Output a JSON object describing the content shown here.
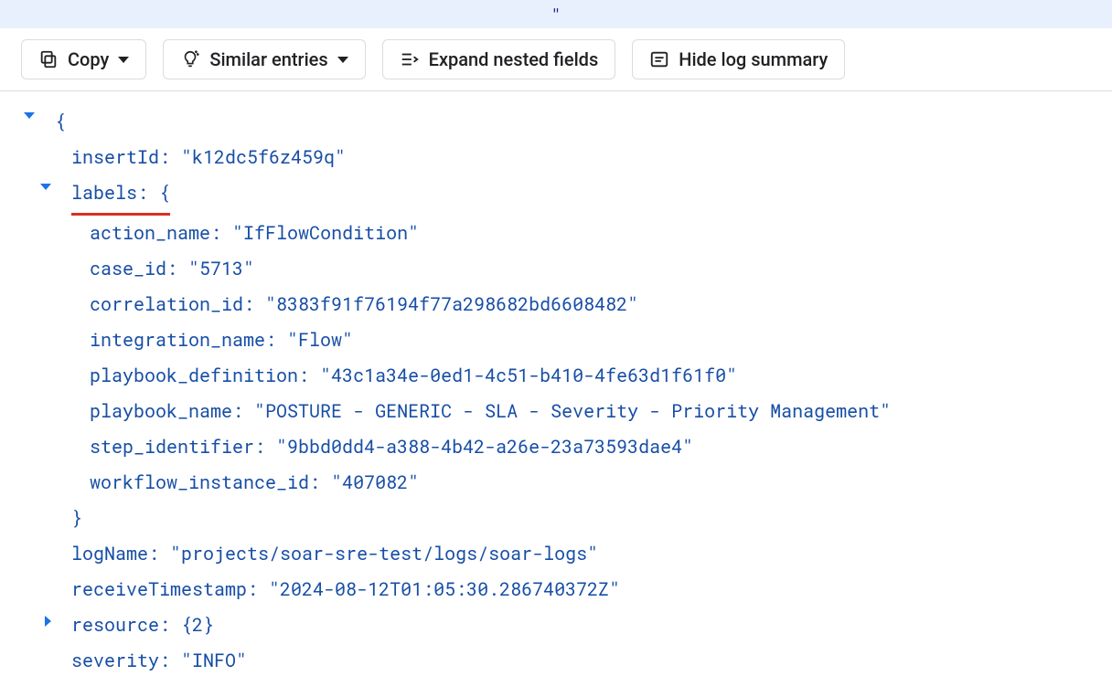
{
  "topstrip": {
    "char": "\""
  },
  "toolbar": {
    "copy": "Copy",
    "similar": "Similar entries",
    "expand": "Expand nested fields",
    "hide": "Hide log summary"
  },
  "log": {
    "open_brace": "{",
    "insertId": {
      "key": "insertId",
      "value": "\"k12dc5f6z459q\""
    },
    "labels_key": "labels",
    "labels_open": "{",
    "labels": {
      "action_name": {
        "key": "action_name",
        "value": "\"IfFlowCondition\""
      },
      "case_id": {
        "key": "case_id",
        "value": "\"5713\""
      },
      "correlation_id": {
        "key": "correlation_id",
        "value": "\"8383f91f76194f77a298682bd6608482\""
      },
      "integration_name": {
        "key": "integration_name",
        "value": "\"Flow\""
      },
      "playbook_definition": {
        "key": "playbook_definition",
        "value": "\"43c1a34e-0ed1-4c51-b410-4fe63d1f61f0\""
      },
      "playbook_name": {
        "key": "playbook_name",
        "value": "\"POSTURE - GENERIC - SLA - Severity - Priority Management\""
      },
      "step_identifier": {
        "key": "step_identifier",
        "value": "\"9bbd0dd4-a388-4b42-a26e-23a73593dae4\""
      },
      "workflow_instance_id": {
        "key": "workflow_instance_id",
        "value": "\"407082\""
      }
    },
    "labels_close": "}",
    "logName": {
      "key": "logName",
      "value": "\"projects/soar-sre-test/logs/soar-logs\""
    },
    "receiveTimestamp": {
      "key": "receiveTimestamp",
      "value": "\"2024-08-12T01:05:30.286740372Z\""
    },
    "resource": {
      "key": "resource",
      "summary": "{2}"
    },
    "severity": {
      "key": "severity",
      "value": "\"INFO\""
    }
  },
  "colon_sep": ": "
}
